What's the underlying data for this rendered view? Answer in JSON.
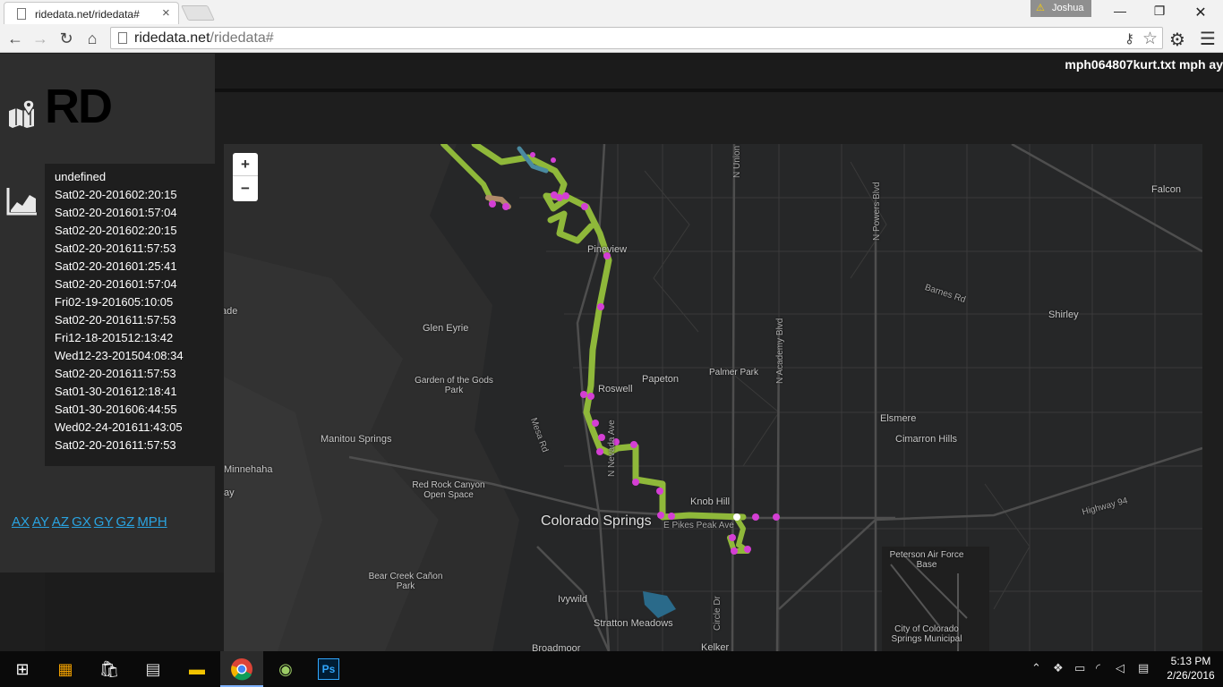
{
  "browser": {
    "tab_title": "ridedata.net/ridedata#",
    "tab_close": "×",
    "profile_name": "Joshua",
    "url_host": "ridedata.net",
    "url_path": "/ridedata#",
    "window_controls": {
      "minimize": "—",
      "maximize": "❐",
      "close": "✕"
    },
    "nav": {
      "back": "←",
      "forward": "→",
      "reload": "↻",
      "home": "⌂"
    }
  },
  "page": {
    "file_label": "mph064807kurt.txt mph ay",
    "logo_text": "RD",
    "rides": [
      "undefined",
      "Sat02-20-201602:20:15",
      "Sat02-20-201601:57:04",
      "Sat02-20-201602:20:15",
      "Sat02-20-201611:57:53",
      "Sat02-20-201601:25:41",
      "Sat02-20-201601:57:04",
      "Fri02-19-201605:10:05",
      "Sat02-20-201611:57:53",
      "Fri12-18-201512:13:42",
      "Wed12-23-201504:08:34",
      "Sat02-20-201611:57:53",
      "Sat01-30-201612:18:41",
      "Sat01-30-201606:44:55",
      "Wed02-24-201611:43:05",
      "Sat02-20-201611:57:53"
    ],
    "metrics": [
      "AX",
      "AY",
      "AZ",
      "GX",
      "GY",
      "GZ",
      "MPH"
    ],
    "colors": {
      "link": "#2aa3e0",
      "track_green": "#8fb83a",
      "track_magenta": "#d43fd4"
    }
  },
  "map": {
    "zoom_in": "+",
    "zoom_out": "−",
    "labels": {
      "glen_eyrie": "Glen Eyrie",
      "pineview": "Pineview",
      "garden_of_the_gods": "Garden of the Gods Park",
      "roswell": "Roswell",
      "papeton": "Papeton",
      "palmer_park": "Palmer Park",
      "manitou_springs": "Manitou Springs",
      "minnehaha": "Minnehaha",
      "red_rock_canyon": "Red Rock Canyon Open Space",
      "colorado_springs": "Colorado Springs",
      "knob_hill": "Knob Hill",
      "e_pikes_peak_ave": "E Pikes Peak Ave",
      "bear_creek": "Bear Creek Cañon Park",
      "ivywild": "Ivywild",
      "stratton_meadows": "Stratton Meadows",
      "broadmoor": "Broadmoor",
      "kelker": "Kelker",
      "falcon": "Falcon",
      "shirley": "Shirley",
      "elsmere": "Elsmere",
      "cimarron_hills": "Cimarron Hills",
      "peterson_afb": "Peterson Air Force Base",
      "city_airport": "City of Colorado Springs Municipal",
      "ade": "ade",
      "ay": "ay"
    },
    "roads": {
      "n_union": "N Union Blvd",
      "n_powers": "N Powers Blvd",
      "barnes": "Barnes Rd",
      "n_academy": "N Academy Blvd",
      "mesa_rd": "Mesa Rd",
      "n_nevada": "N Nevada Ave",
      "circle_dr": "Circle Dr",
      "highway_94": "Highway 94"
    }
  },
  "taskbar": {
    "start": "⊞",
    "ps": "Ps",
    "time": "5:13 PM",
    "date": "2/26/2016"
  }
}
